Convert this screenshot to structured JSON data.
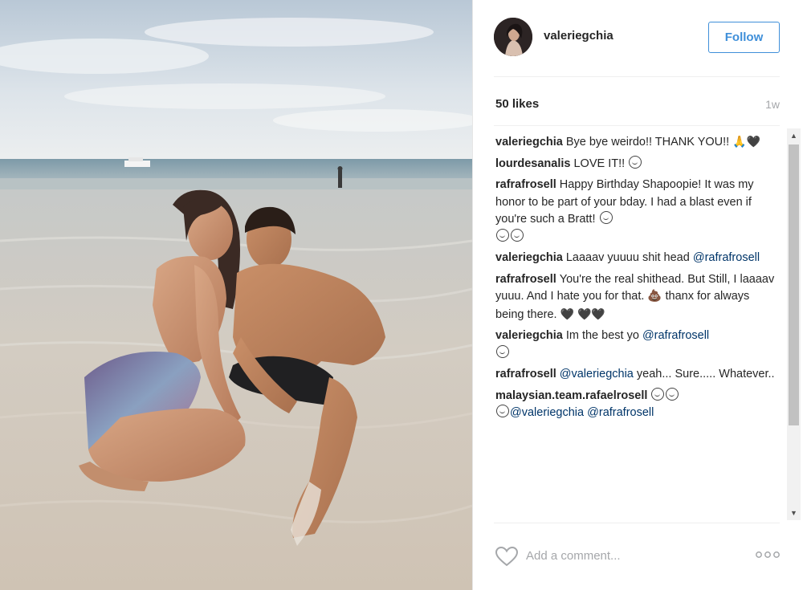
{
  "post": {
    "username": "valeriegchia",
    "follow_label": "Follow",
    "likes": "50 likes",
    "age": "1w"
  },
  "comments": [
    {
      "author": "valeriegchia",
      "text": "Bye bye weirdo!! THANK YOU!!",
      "suffix": "🙏🖤"
    },
    {
      "author": "lourdesanalis",
      "text": "LOVE IT!!",
      "suffix": ""
    },
    {
      "author": "rafrafrosell",
      "text": "Happy Birthday Shapoopie! It was my honor to be part of your bday. I had a blast even if you're such a Bratt!",
      "suffix": ""
    },
    {
      "author": "valeriegchia",
      "text": "Laaaav yuuuu shit head",
      "mention": "@rafrafrosell"
    },
    {
      "author": "rafrafrosell",
      "text": "You're the real shithead. But Still, I laaaav yuuu. And I hate you for that. 💩 thanx for always being there.",
      "suffix": "🖤 🖤🖤"
    },
    {
      "author": "valeriegchia",
      "text": "Im the best yo",
      "mention": "@rafrafrosell"
    },
    {
      "author": "rafrafrosell",
      "mention_first": "@valeriegchia",
      "text": "yeah... Sure..... Whatever.."
    },
    {
      "author": "malaysian.team.rafaelrosell",
      "mention_first": "@valeriegchia",
      "mention": "@rafrafrosell"
    }
  ],
  "footer": {
    "comment_placeholder": "Add a comment..."
  },
  "icons": {
    "like": "heart-outline-icon",
    "more": "ellipsis-icon"
  },
  "colors": {
    "accent": "#3f8fd9",
    "mention": "#003569",
    "muted": "#a5a7aa"
  }
}
